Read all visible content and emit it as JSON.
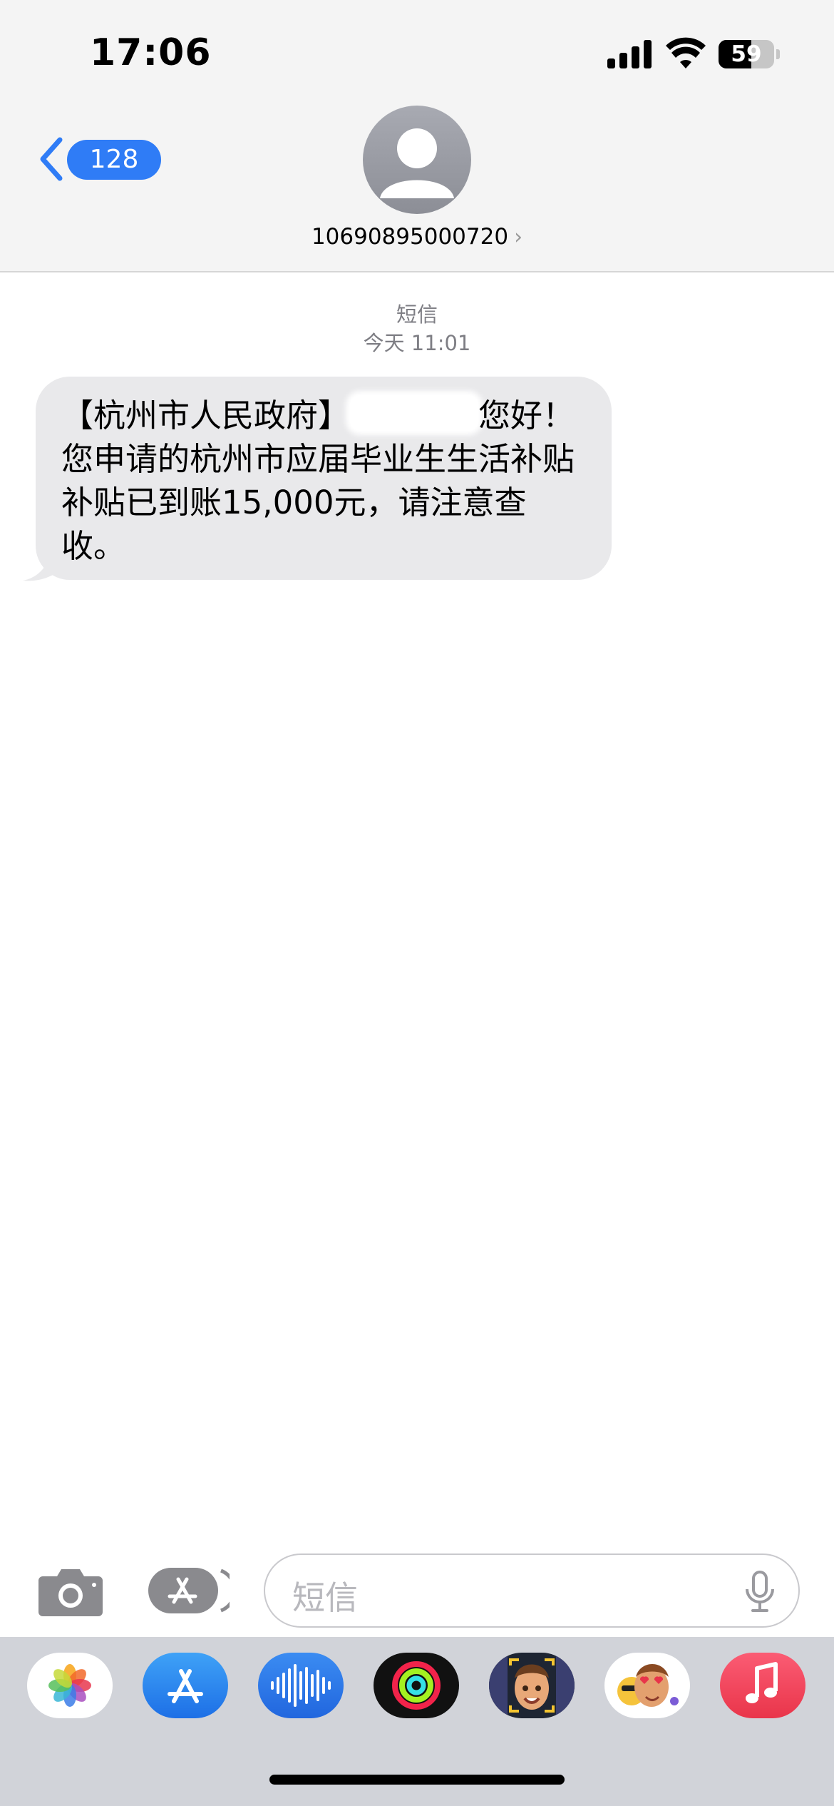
{
  "status_bar": {
    "time": "17:06",
    "battery_level": "59",
    "battery_fraction": 0.59
  },
  "header": {
    "back_badge_count": "128",
    "sender_number": "10690895000720",
    "sender_chevron": "›"
  },
  "conversation": {
    "service_label": "短信",
    "timestamp": "今天 11:01",
    "message": {
      "part_before_redaction": "【杭州市人民政府】",
      "part_after_redaction": "您好！您申请的杭州市应届毕业生生活补贴补贴已到账15,000元，请注意查收。"
    }
  },
  "input_bar": {
    "placeholder": "短信"
  },
  "app_drawer": {
    "apps": [
      {
        "name": "photos-app-icon"
      },
      {
        "name": "app-store-app-icon"
      },
      {
        "name": "audio-message-app-icon"
      },
      {
        "name": "fitness-app-icon"
      },
      {
        "name": "memoji-app-icon"
      },
      {
        "name": "memoji-stickers-app-icon"
      },
      {
        "name": "music-app-icon"
      }
    ]
  },
  "colors": {
    "accent_blue": "#2f7cf6",
    "bubble_gray": "#e9e9eb",
    "header_bg": "#f4f4f4",
    "drawer_bg": "#d1d3d9"
  }
}
